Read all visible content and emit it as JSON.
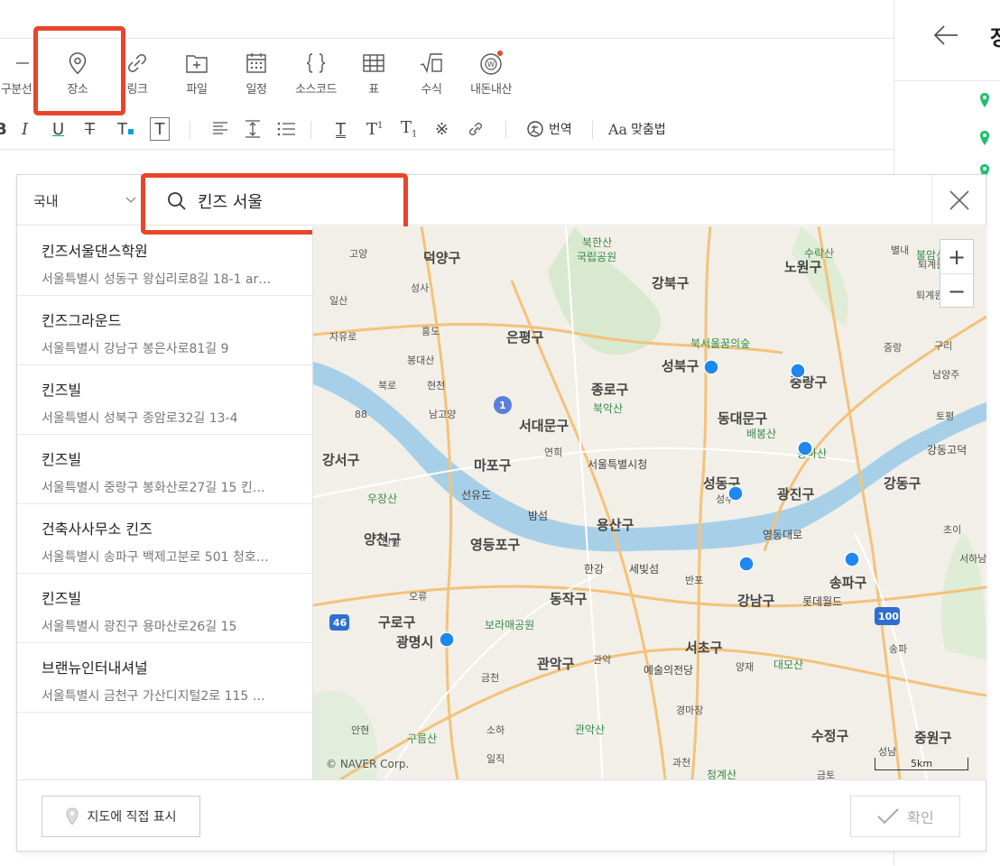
{
  "toolbar": {
    "items": [
      {
        "label": "구분선",
        "icon": "divider-icon"
      },
      {
        "label": "장소",
        "icon": "location-pin-icon"
      },
      {
        "label": "링크",
        "icon": "link-icon"
      },
      {
        "label": "파일",
        "icon": "file-add-icon"
      },
      {
        "label": "일정",
        "icon": "calendar-icon"
      },
      {
        "label": "소스코드",
        "icon": "code-braces-icon"
      },
      {
        "label": "표",
        "icon": "table-icon"
      },
      {
        "label": "수식",
        "icon": "formula-icon"
      },
      {
        "label": "내돈내산",
        "icon": "mydonnaesan-icon"
      }
    ],
    "translate_label": "번역",
    "spellcheck_label": "맞춤법",
    "highlight_color": "#e8452a"
  },
  "right_panel": {
    "title": "장"
  },
  "dialog": {
    "region": "국내",
    "search_value": "킨즈 서울",
    "results": [
      {
        "name": "킨즈서울댄스학원",
        "address": "서울특별시 성동구 왕십리로8길 18-1 ar…"
      },
      {
        "name": "킨즈그라운드",
        "address": "서울특별시 강남구 봉은사로81길 9"
      },
      {
        "name": "킨즈빌",
        "address": "서울특별시 성북구 종암로32길 13-4"
      },
      {
        "name": "킨즈빌",
        "address": "서울특별시 중랑구 봉화산로27길 15 킨…"
      },
      {
        "name": "건축사사무소 킨즈",
        "address": "서울특별시 송파구 백제고분로 501 청호…"
      },
      {
        "name": "킨즈빌",
        "address": "서울특별시 광진구 용마산로26길 15"
      },
      {
        "name": "브랜뉴인터내셔널",
        "address": "서울특별시 금천구 가산디지털2로 115 …"
      }
    ],
    "direct_label": "지도에 직접 표시",
    "confirm_label": "확인"
  },
  "map": {
    "copyright": "© NAVER Corp.",
    "scale_label": "5km",
    "zoom_in": "+",
    "zoom_out": "−",
    "districts": [
      "덕양구",
      "노원구",
      "강북구",
      "은평구",
      "성북구",
      "중랑구",
      "종로구",
      "동대문구",
      "서대문구",
      "마포구",
      "강서구",
      "양천구",
      "영등포구",
      "용산구",
      "성동구",
      "광진구",
      "강동구",
      "동작구",
      "구로구",
      "광명시",
      "관악구",
      "서초구",
      "강남구",
      "송파구",
      "수정구",
      "중원구"
    ],
    "landmarks": [
      "북한산국립공원",
      "북서울꿈의숲",
      "배봉산",
      "용마산",
      "북악산",
      "서울특별시청",
      "우장산",
      "보라매공원",
      "예술의전당",
      "롯데월드",
      "대모산",
      "관악산",
      "구름산",
      "청계산",
      "수락산",
      "불암산"
    ],
    "road_labels": [
      "고양",
      "성사",
      "일산",
      "자유로",
      "홍도",
      "봉대산",
      "북로",
      "현천",
      "남고양",
      "88",
      "연희",
      "선유도",
      "밤섬",
      "한강",
      "세빛섬",
      "신월",
      "오류",
      "금천",
      "소하",
      "일직",
      "안현",
      "관악",
      "양재",
      "반포",
      "경마장",
      "과천",
      "금토",
      "성남",
      "송파",
      "초이",
      "서하남",
      "영동대로",
      "강동고덕",
      "토평",
      "구리",
      "남양주",
      "중랑",
      "퇴계원",
      "별내",
      "퇴계원읍",
      "성수",
      "46",
      "100",
      "1"
    ]
  }
}
